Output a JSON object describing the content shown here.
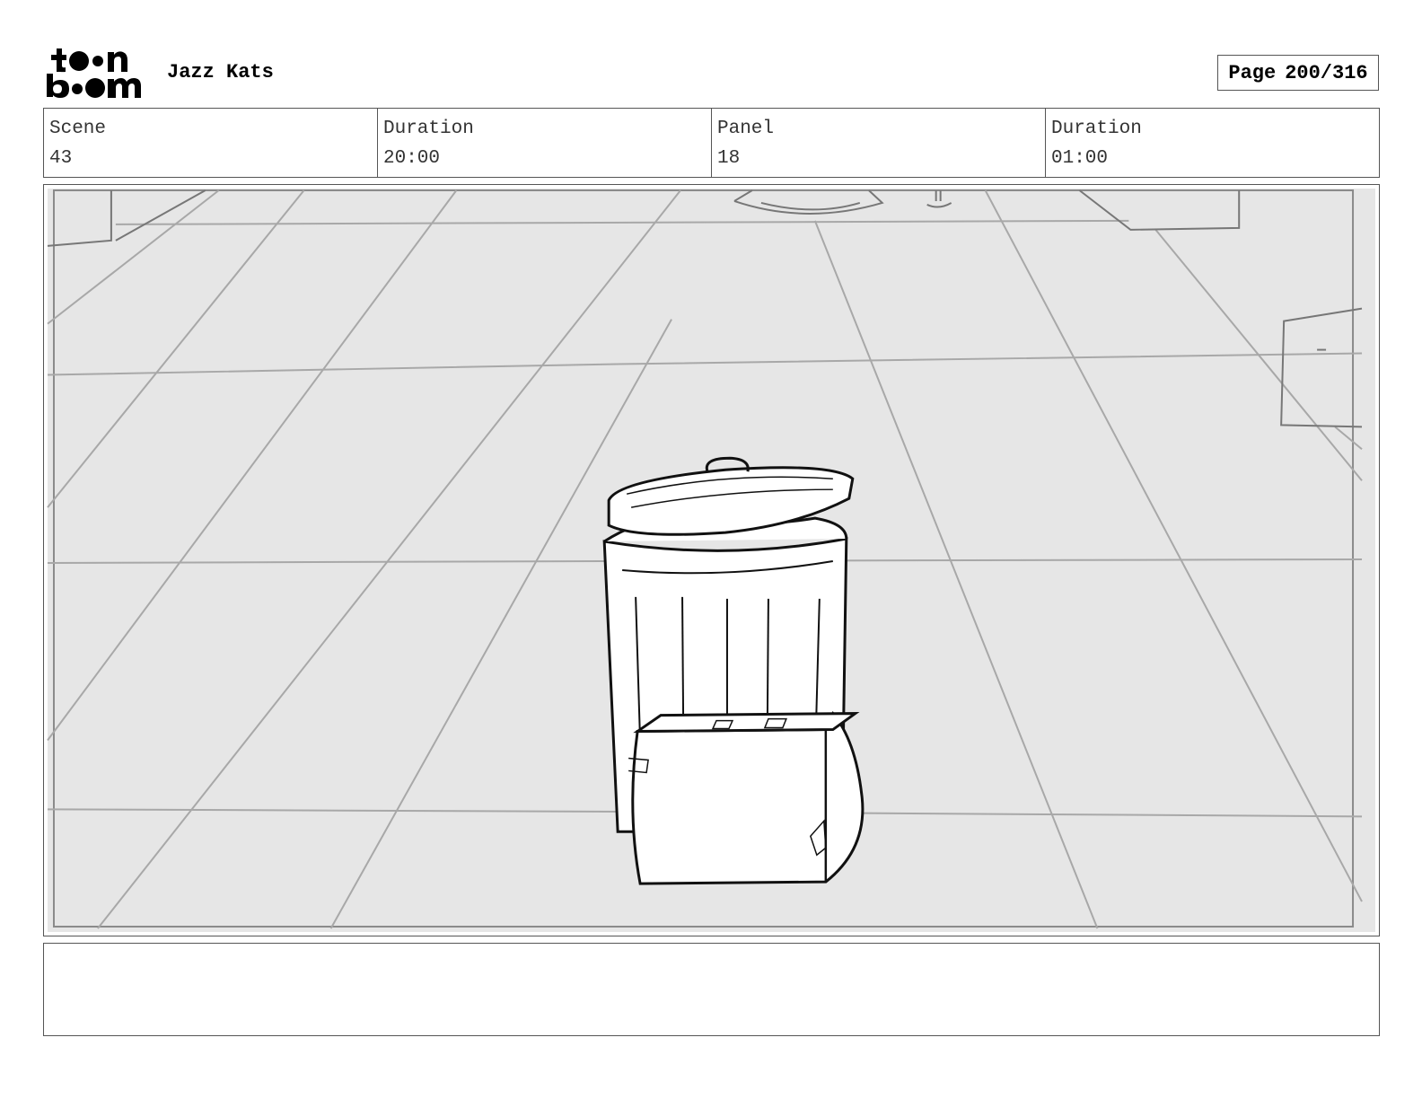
{
  "header": {
    "logo_text": "toon boom",
    "project_title": "Jazz Kats",
    "page_label": "Page",
    "page_value": "200/316"
  },
  "info": {
    "scene_label": "Scene",
    "scene_value": "43",
    "scene_duration_label": "Duration",
    "scene_duration_value": "20:00",
    "panel_label": "Panel",
    "panel_value": "18",
    "panel_duration_label": "Duration",
    "panel_duration_value": "01:00"
  },
  "notes": {
    "text": ""
  },
  "colors": {
    "border": "#555555",
    "floor": "#e6e6e6",
    "sketch_gray": "#a8a8a8"
  }
}
